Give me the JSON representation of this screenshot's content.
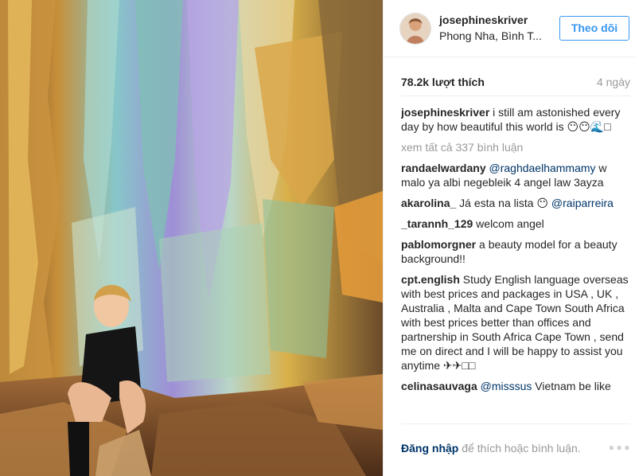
{
  "post": {
    "username": "josephineskriver",
    "location": "Phong Nha, Bình T...",
    "follow_label": "Theo dõi",
    "likes": "78.2k lượt thích",
    "time_ago": "4 ngày"
  },
  "caption": {
    "user": "josephineskriver",
    "text": "i still am astonished every day by how beautiful this world is 😶😶🌊□"
  },
  "view_all_comments": "xem tất cả 337 bình luận",
  "comments": [
    {
      "user": "randaelwardany",
      "mention": "@raghdaelhammamy",
      "text": " w malo ya albi negebleik 4 angel law 3ayza"
    },
    {
      "user": "akarolina_",
      "text": "Já esta na lista 😶 ",
      "mention_after": "@raiparreira"
    },
    {
      "user": "_tarannh_129",
      "text": "welcom angel"
    },
    {
      "user": "pablomorgner",
      "text": "a beauty model for a beauty background!!"
    },
    {
      "user": "cpt.english",
      "text": "Study English language overseas with best prices and packages in USA , UK , Australia , Malta and Cape Town South Africa with best prices better than offices and partnership in South Africa Cape Town , send me on direct and I will be happy to assist you anytime ✈✈□□"
    },
    {
      "user": "celinasauvaga",
      "mention": "@misssus",
      "text": " Vietnam be like"
    }
  ],
  "footer": {
    "login_link": "Đăng nhập",
    "login_rest": " để thích hoặc bình luận.",
    "more": "∘∘∘"
  },
  "icons": {
    "more": "more-options-icon",
    "avatar": "avatar"
  },
  "colors": {
    "accent": "#3897f0",
    "link": "#003569",
    "muted": "#999999",
    "text": "#262626"
  }
}
